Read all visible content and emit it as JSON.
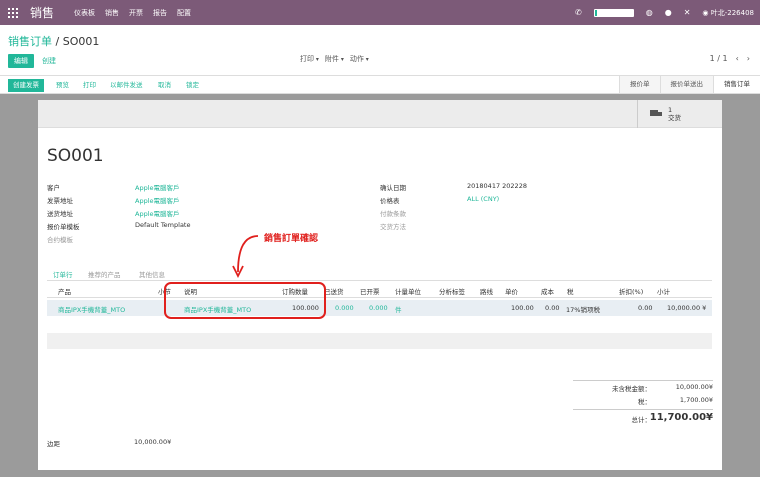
{
  "app": {
    "name": "销售",
    "menu": [
      "仪表板",
      "销售",
      "开票",
      "报告",
      "配置"
    ],
    "user": "叶北-226408"
  },
  "breadcrumb": {
    "parent": "销售订单",
    "separator": "/",
    "current": "SO001"
  },
  "control": {
    "edit": "编辑",
    "create": "创建",
    "dropdowns": [
      "打印",
      "附件",
      "动作"
    ],
    "pager": "1 / 1"
  },
  "statusbar": {
    "primary": "创建发票",
    "buttons": [
      "预览",
      "打印",
      "以邮件发送",
      "取消",
      "锁定"
    ],
    "stages": [
      {
        "label": "报价单",
        "active": false
      },
      {
        "label": "报价单送出",
        "active": false
      },
      {
        "label": "销售订单",
        "active": true
      }
    ]
  },
  "smart_button": {
    "count": "1",
    "label": "交货"
  },
  "order": {
    "name": "SO001",
    "left_fields": [
      {
        "label": "客户",
        "value": "Apple電腦客戶",
        "link": true
      },
      {
        "label": "发票地址",
        "value": "Apple電腦客戶",
        "link": true
      },
      {
        "label": "送货地址",
        "value": "Apple電腦客戶",
        "link": true
      },
      {
        "label": "报价单模板",
        "value": "Default Template",
        "link": false
      },
      {
        "label": "合约模板",
        "value": "",
        "link": false
      }
    ],
    "right_fields": [
      {
        "label": "确认日期",
        "value": "20180417 202228",
        "link": false
      },
      {
        "label": "价格表",
        "value": "ALL (CNY)",
        "link": true
      },
      {
        "label": "付款条款",
        "value": "",
        "link": false
      },
      {
        "label": "交货方法",
        "value": "",
        "link": false
      }
    ]
  },
  "annotation": "銷售訂單確認",
  "tabs": [
    {
      "label": "订单行",
      "active": true
    },
    {
      "label": "推荐的产品",
      "active": false
    },
    {
      "label": "其他信息",
      "active": false
    }
  ],
  "table": {
    "headers": [
      "产品",
      "小节",
      "说明",
      "订购数量",
      "已送货",
      "已开票",
      "计量单位",
      "分析标签",
      "路线",
      "单价",
      "成本",
      "税",
      "折扣(%)",
      "小计"
    ],
    "rows": [
      [
        "商品IPX手機背蓋_MTO",
        "",
        "商品IPX手機背蓋_MTO",
        "100.000",
        "0.000",
        "0.000",
        "件",
        "",
        "",
        "100.00",
        "0.00",
        "17%销项税",
        "0.00",
        "10,000.00 ¥"
      ]
    ]
  },
  "totals": {
    "untaxed_label": "未含税金额：",
    "untaxed": "10,000.00¥",
    "tax_label": "税：",
    "tax": "1,700.00¥",
    "total_label": "总计：",
    "total": "11,700.00¥"
  },
  "footer": {
    "label": "边距",
    "value": "10,000.00¥"
  }
}
